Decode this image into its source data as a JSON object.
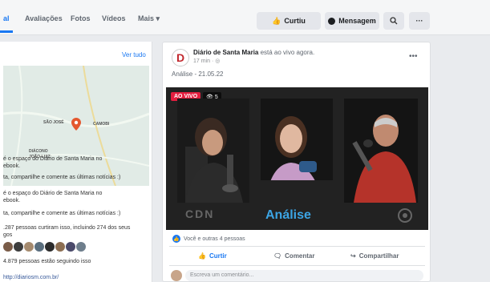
{
  "nav": {
    "tabs": [
      {
        "label": "al"
      },
      {
        "label": "Avaliações"
      },
      {
        "label": "Fotos"
      },
      {
        "label": "Vídeos"
      },
      {
        "label": "Mais ▾"
      }
    ],
    "like_btn": "Curtiu",
    "message_btn": "Mensagem"
  },
  "left": {
    "see_all": "Ver tudo",
    "map_labels": [
      "SÃO JOSÉ",
      "CAMOBI",
      "DIÁCONO",
      "JOÃO LUIZ"
    ],
    "about_lines": [
      "é o espaço do Diário de Santa Maria no",
      "ebook.",
      "ta, compartilhe e comente as últimas notícias :)",
      "é o espaço do Diário de Santa Maria no",
      "ebook.",
      "ta, compartilhe e comente as últimas notícias :)",
      ".287 pessoas curtiram isso, incluindo 274 dos seus",
      "gos",
      "4.879 pessoas estão seguindo isso",
      "http://diariosm.com.br/"
    ]
  },
  "post": {
    "avatar_letter": "D",
    "author": "Diário de Santa Maria",
    "status": " está ao vivo agora.",
    "time": "17 min · ",
    "text": "Análise - 21.05.22",
    "live_label": "AO VIVO",
    "viewers": "👁 5",
    "video_logo_left": "CDN",
    "video_logo_center": "Análise",
    "reactions_text": "Você e outras 4 pessoas",
    "actions": {
      "like": "Curtir",
      "comment": "Comentar",
      "share": "Compartilhar"
    },
    "comment_placeholder": "Escreva um comentário..."
  },
  "colors": {
    "brand_blue": "#1877f2",
    "live_red": "#e41e3f",
    "analise_blue": "#3ca5e5"
  }
}
